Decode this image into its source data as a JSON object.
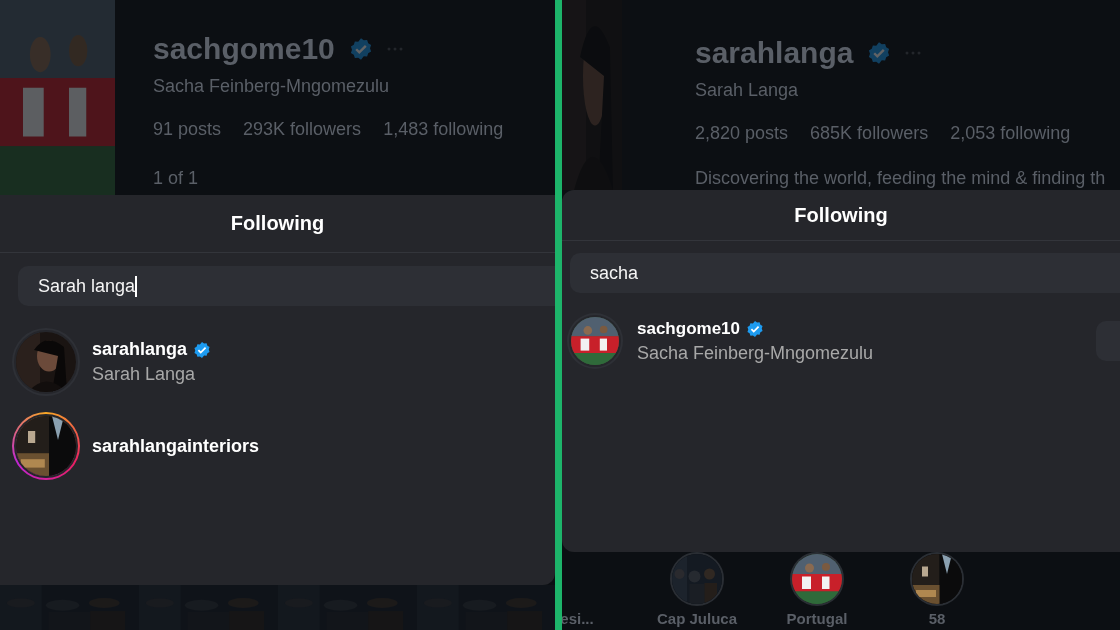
{
  "panels": [
    {
      "profile": {
        "username": "sachgome10",
        "verified": true,
        "full_name": "Sacha Feinberg-Mngomezulu",
        "stats": [
          "91 posts",
          "293K followers",
          "1,483 following"
        ],
        "extra": "1 of 1"
      },
      "dialog": {
        "title": "Following",
        "search": "Sarah langa",
        "focused": true,
        "results": [
          {
            "username": "sarahlanga",
            "verified": true,
            "full_name": "Sarah Langa",
            "story_ring": false
          },
          {
            "username": "sarahlangainteriors",
            "verified": false,
            "story_ring": true
          }
        ]
      },
      "below": {
        "kind": "photos"
      }
    },
    {
      "profile": {
        "username": "sarahlanga",
        "verified": true,
        "full_name": "Sarah Langa",
        "stats": [
          "2,820 posts",
          "685K followers",
          "2,053 following"
        ],
        "bio": "Discovering the world, feeding the mind & finding th"
      },
      "dialog": {
        "title": "Following",
        "search": "sacha",
        "results": [
          {
            "username": "sachgome10",
            "verified": true,
            "full_name": "Sacha Feinberg-Mngomezulu",
            "story_ring": false
          }
        ],
        "side_button": true
      },
      "below": {
        "kind": "highlights",
        "labels": [
          "esi...",
          "Cap Juluca",
          "Portugal",
          "58"
        ]
      }
    }
  ]
}
